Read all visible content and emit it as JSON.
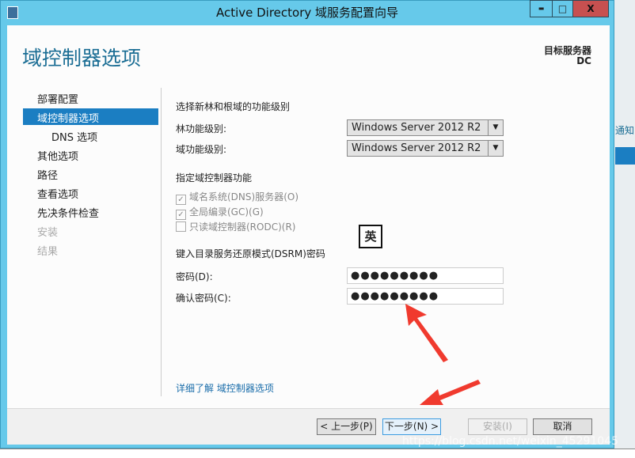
{
  "window": {
    "title": "Active Directory 域服务配置向导",
    "min": "▬",
    "max": "□",
    "close": "X"
  },
  "page_title": "域控制器选项",
  "target": {
    "label": "目标服务器",
    "name": "DC"
  },
  "sidebar": {
    "items": [
      {
        "label": "部署配置"
      },
      {
        "label": "域控制器选项"
      },
      {
        "label": "DNS 选项"
      },
      {
        "label": "其他选项"
      },
      {
        "label": "路径"
      },
      {
        "label": "查看选项"
      },
      {
        "label": "先决条件检查"
      },
      {
        "label": "安装"
      },
      {
        "label": "结果"
      }
    ]
  },
  "levels": {
    "heading": "选择新林和根域的功能级别",
    "forest_label": "林功能级别:",
    "forest_value": "Windows Server 2012 R2",
    "domain_label": "域功能级别:",
    "domain_value": "Windows Server 2012 R2"
  },
  "roles": {
    "heading": "指定域控制器功能",
    "items": [
      {
        "label": "域名系统(DNS)服务器(O)",
        "checked": true
      },
      {
        "label": "全局编录(GC)(G)",
        "checked": true
      },
      {
        "label": "只读域控制器(RODC)(R)",
        "checked": false
      }
    ]
  },
  "ime": "英",
  "dsrm": {
    "heading": "键入目录服务还原模式(DSRM)密码",
    "password_label": "密码(D):",
    "password_value": "●●●●●●●●●",
    "confirm_label": "确认密码(C):",
    "confirm_value": "●●●●●●●●●"
  },
  "more_link": "详细了解 域控制器选项",
  "buttons": {
    "prev": "< 上一步(P)",
    "next": "下一步(N) >",
    "install": "安装(I)",
    "cancel": "取消"
  },
  "background": {
    "notify": "通知"
  },
  "watermark": "https://blog.csdn.net/weixin_45291045",
  "colors": {
    "accent": "#1a6d94",
    "selected": "#1b7ec2",
    "frame": "#66c9ea",
    "arrow": "#f03a2e"
  }
}
